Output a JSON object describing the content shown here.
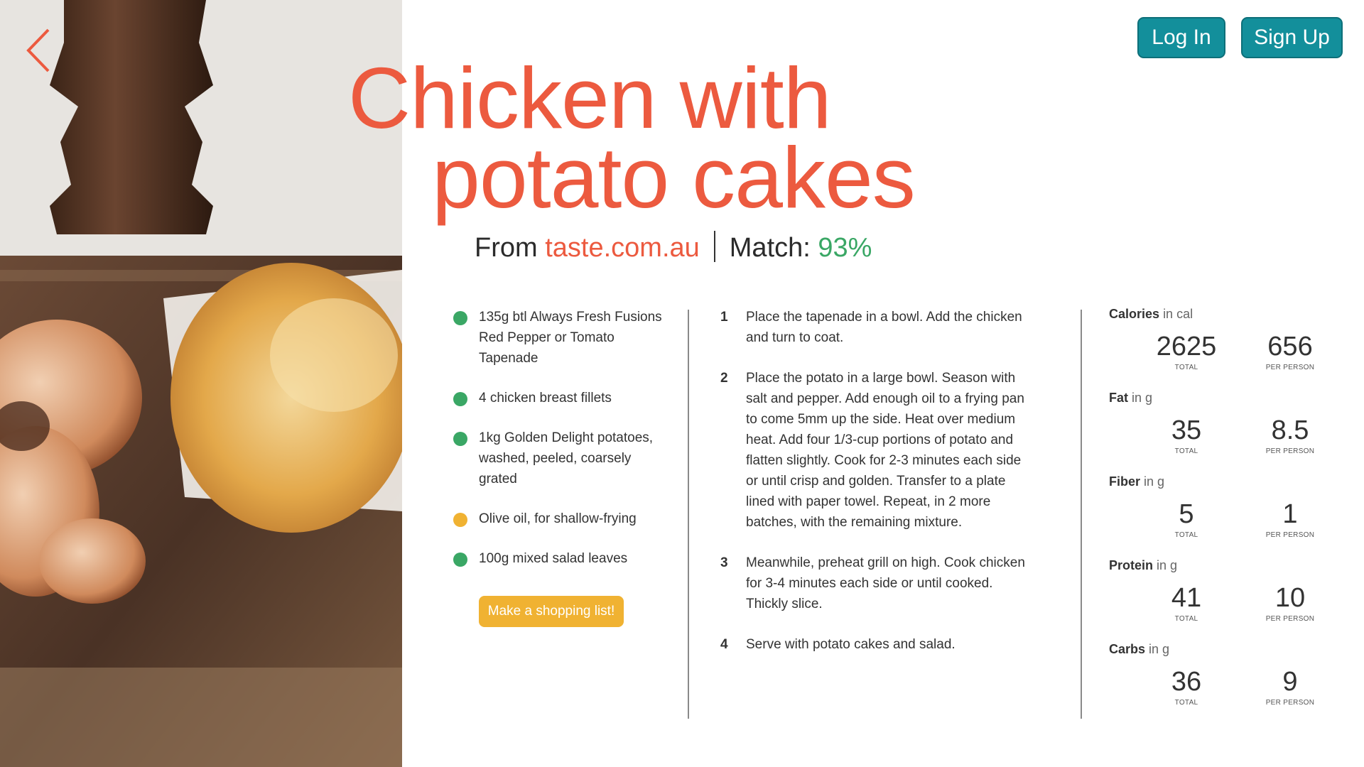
{
  "recipe": {
    "title_line1": "Chicken with",
    "title_line2": "potato cakes",
    "source_prefix": "From",
    "source_site": "taste.com.au",
    "match_label": "Match:",
    "match_value": "93%"
  },
  "header": {
    "login_label": "Log In",
    "signup_label": "Sign Up",
    "back_icon": "chevron-left-icon"
  },
  "colors": {
    "accent": "#ec5a3f",
    "teal": "#138f9b",
    "green_dot": "#3aa765",
    "yellow_dot": "#f0b232",
    "match": "#3aa765"
  },
  "ingredients": [
    {
      "text": "135g btl Always Fresh Fusions Red Pepper or Tomato Tapenade",
      "status": "green"
    },
    {
      "text": "4 chicken breast fillets",
      "status": "green"
    },
    {
      "text": "1kg Golden Delight potatoes, washed, peeled, coarsely grated",
      "status": "green"
    },
    {
      "text": "Olive oil, for shallow-frying",
      "status": "yellow"
    },
    {
      "text": "100g mixed salad leaves",
      "status": "green"
    }
  ],
  "shopping_button_label": "Make a shopping list!",
  "steps": [
    {
      "num": "1",
      "text": "Place the tapenade in a bowl. Add the chicken and turn to coat."
    },
    {
      "num": "2",
      "text": "Place the potato in a large bowl. Season with salt and pepper. Add enough oil to a frying pan to come 5mm up the side. Heat over medium heat. Add four 1/3-cup portions of potato and flatten slightly. Cook for 2-3 minutes each side or until crisp and golden. Transfer to a plate lined with paper towel. Repeat, in 2 more batches, with the remaining mixture."
    },
    {
      "num": "3",
      "text": "Meanwhile, preheat grill on high. Cook chicken for 3-4 minutes each side or until cooked. Thickly slice."
    },
    {
      "num": "4",
      "text": "Serve with potato cakes and salad."
    }
  ],
  "nutrition": {
    "total_caption": "TOTAL",
    "per_person_caption": "PER PERSON",
    "items": [
      {
        "name": "Calories",
        "unit": "in cal",
        "total": "2625",
        "per_person": "656"
      },
      {
        "name": "Fat",
        "unit": "in g",
        "total": "35",
        "per_person": "8.5"
      },
      {
        "name": "Fiber",
        "unit": "in g",
        "total": "5",
        "per_person": "1"
      },
      {
        "name": "Protein",
        "unit": "in g",
        "total": "41",
        "per_person": "10"
      },
      {
        "name": "Carbs",
        "unit": "in g",
        "total": "36",
        "per_person": "9"
      }
    ]
  }
}
